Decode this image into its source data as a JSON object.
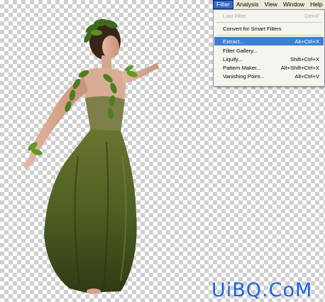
{
  "menubar": {
    "items": [
      "Filter",
      "Analysis",
      "View",
      "Window",
      "Help"
    ],
    "active": "Filter"
  },
  "filter_menu": {
    "last_filter": {
      "label": "Last Filter",
      "shortcut": "Ctrl+F"
    },
    "convert_smart": {
      "label": "Convert for Smart Filters"
    },
    "extract": {
      "label": "Extract...",
      "shortcut": "Alt+Ctrl+X"
    },
    "filter_gallery": {
      "label": "Filter Gallery..."
    },
    "liquify": {
      "label": "Liquify...",
      "shortcut": "Shift+Ctrl+X"
    },
    "pattern_maker": {
      "label": "Pattern Maker...",
      "shortcut": "Alt+Shift+Ctrl+X"
    },
    "vanishing_point": {
      "label": "Vanishing Point...",
      "shortcut": "Alt+Ctrl+V"
    }
  },
  "watermark": "UiBQ.CoM",
  "colors": {
    "menu_highlight": "#3d7fd6",
    "dress_green": "#4d5d1e",
    "watermark_blue": "#1d63e0"
  }
}
